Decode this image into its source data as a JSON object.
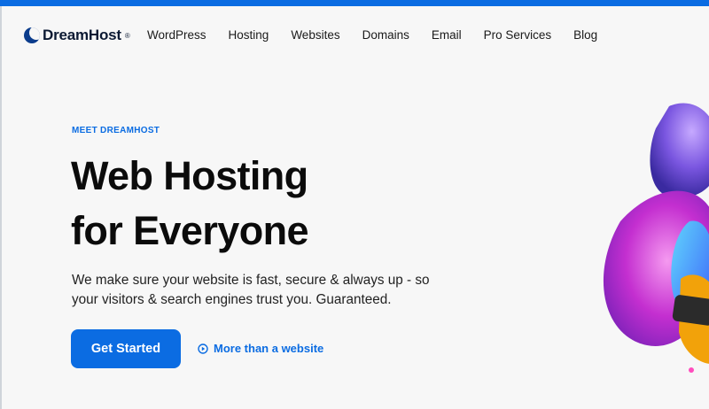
{
  "brand": {
    "name": "DreamHost",
    "tm": "®"
  },
  "nav": {
    "items": [
      "WordPress",
      "Hosting",
      "Websites",
      "Domains",
      "Email",
      "Pro Services",
      "Blog"
    ]
  },
  "hero": {
    "eyebrow": "MEET DREAMHOST",
    "headline_line1": "Web Hosting",
    "headline_line2": "for Everyone",
    "subtext_line1": "We make sure your website is fast, secure & always up - so",
    "subtext_line2": "your visitors & search engines trust you. Guaranteed.",
    "cta_label": "Get Started",
    "secondary_label": "More than a website"
  },
  "colors": {
    "accent": "#0b6ce2",
    "background": "#f7f7f7",
    "text": "#0b0b0b"
  },
  "icons": {
    "logo": "dreamhost-moon-logo",
    "secondary": "play-circle-icon"
  }
}
